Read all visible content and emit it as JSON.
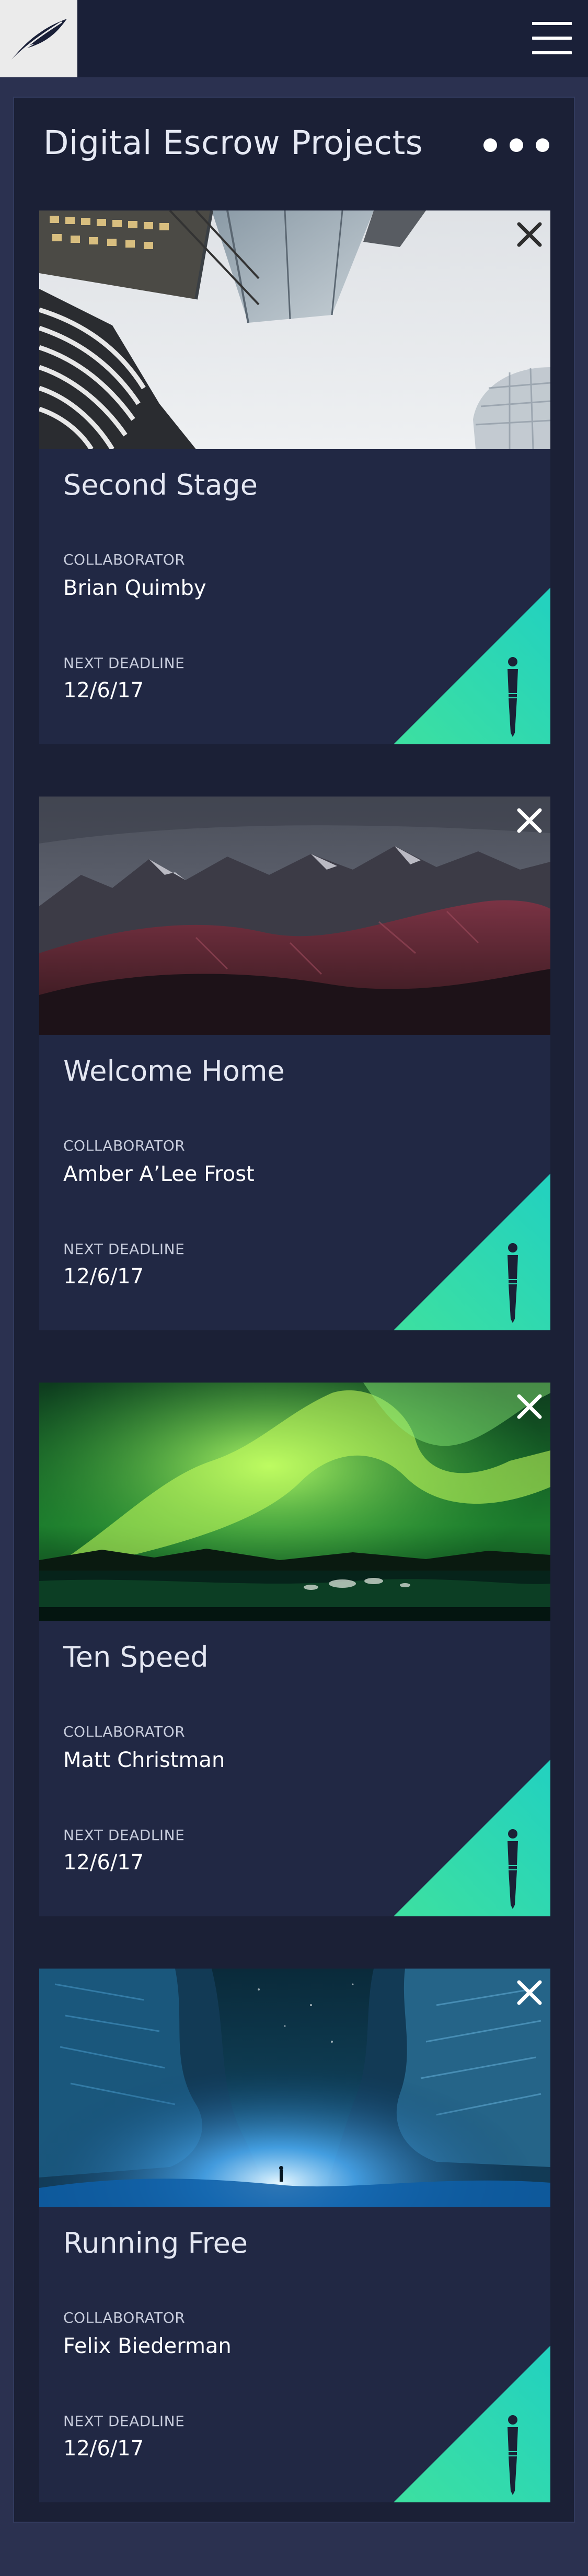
{
  "header": {
    "logo_icon": "quill-icon",
    "menu_icon": "hamburger-menu-icon"
  },
  "page": {
    "title": "Digital Escrow Projects",
    "more_icon": "more-dots-icon"
  },
  "labels": {
    "collaborator": "COLLABORATOR",
    "next_deadline": "NEXT DEADLINE"
  },
  "projects": [
    {
      "title": "Second Stage",
      "collaborator": "Brian Quimby",
      "deadline": "12/6/17",
      "image": "skyscrapers-photo"
    },
    {
      "title": "Welcome Home",
      "collaborator": "Amber A’Lee Frost",
      "deadline": "12/6/17",
      "image": "mountains-photo"
    },
    {
      "title": "Ten Speed",
      "collaborator": "Matt Christman",
      "deadline": "12/6/17",
      "image": "aurora-photo"
    },
    {
      "title": "Running Free",
      "collaborator": "Felix Biederman",
      "deadline": "12/6/17",
      "image": "ice-cave-photo"
    }
  ],
  "colors": {
    "page_bg": "#2b3150",
    "panel_bg": "#1b2036",
    "card_bg": "#212844",
    "accent_start": "#3de0a0",
    "accent_end": "#22d1c0"
  }
}
